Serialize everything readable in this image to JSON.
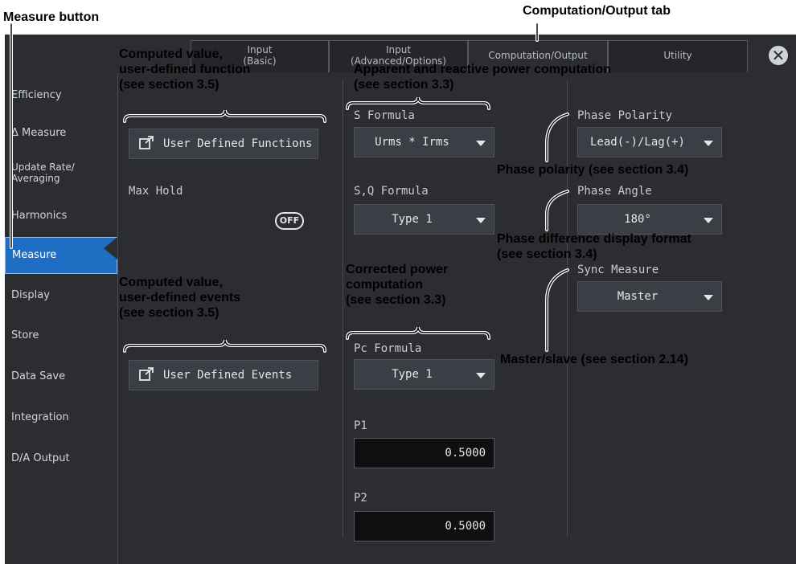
{
  "annotations": {
    "measure_button": "Measure button",
    "computation_tab": "Computation/Output tab",
    "user_function": [
      "Computed value,",
      "user-defined function",
      "(see section 3.5)"
    ],
    "apparent_reactive": [
      "Apparent and reactive power computation",
      "(see section 3.3)"
    ],
    "user_events": [
      "Computed value,",
      "user-defined events",
      "(see section 3.5)"
    ],
    "corrected_power": [
      "Corrected power",
      "computation",
      "(see section 3.3)"
    ],
    "phase_polarity": "Phase polarity (see section 3.4)",
    "phase_diff": [
      "Phase difference display format",
      "(see section 3.4)"
    ],
    "master_slave": "Master/slave (see section 2.14)"
  },
  "tabs": [
    {
      "label": [
        "Input",
        "(Basic)"
      ]
    },
    {
      "label": [
        "Input",
        "(Advanced/Options)"
      ]
    },
    {
      "label": [
        "Computation/Output"
      ]
    },
    {
      "label": [
        "Utility"
      ]
    }
  ],
  "close_icon": "close-icon",
  "sidebar": {
    "items": [
      "Efficiency",
      "Δ Measure",
      "Update Rate/\nAveraging",
      "Harmonics",
      "Measure",
      "Display",
      "Store",
      "Data Save",
      "Integration",
      "D/A Output"
    ],
    "active": "Measure"
  },
  "col1": {
    "user_functions_button": "User Defined Functions",
    "max_hold_label": "Max Hold",
    "max_hold_value": "OFF",
    "user_events_button": "User Defined Events"
  },
  "col2": {
    "s_formula_label": "S Formula",
    "s_formula_value": "Urms * Irms",
    "sq_formula_label": "S,Q Formula",
    "sq_formula_value": "Type 1",
    "pc_formula_label": "Pc Formula",
    "pc_formula_value": "Type 1",
    "p1_label": "P1",
    "p1_value": "0.5000",
    "p2_label": "P2",
    "p2_value": "0.5000"
  },
  "col3": {
    "phase_polarity_label": "Phase Polarity",
    "phase_polarity_value": "Lead(-)/Lag(+)",
    "phase_angle_label": "Phase Angle",
    "phase_angle_value": "180°",
    "sync_measure_label": "Sync Measure",
    "sync_measure_value": "Master"
  },
  "colors": {
    "background": "#2b2d31",
    "active_item": "#1e6fc4",
    "input_bg": "#0e0f11"
  }
}
